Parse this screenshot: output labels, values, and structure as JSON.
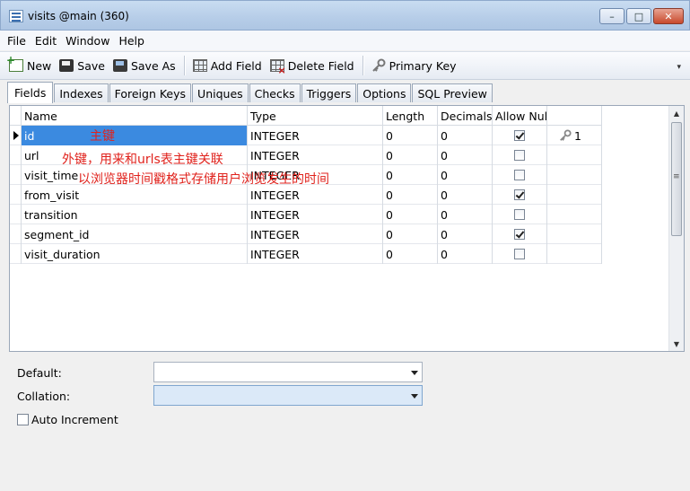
{
  "window": {
    "title": "visits @main (360)",
    "btn_min": "–",
    "btn_max": "□",
    "btn_close": "✕"
  },
  "menu": [
    "File",
    "Edit",
    "Window",
    "Help"
  ],
  "toolbar": {
    "new_label": "New",
    "save_label": "Save",
    "saveas_label": "Save As",
    "addfield_label": "Add Field",
    "deletefield_label": "Delete Field",
    "primarykey_label": "Primary Key",
    "overflow": "▾"
  },
  "tabs": [
    "Fields",
    "Indexes",
    "Foreign Keys",
    "Uniques",
    "Checks",
    "Triggers",
    "Options",
    "SQL Preview"
  ],
  "grid": {
    "headers": {
      "name": "Name",
      "type": "Type",
      "length": "Length",
      "decimals": "Decimals",
      "allow_null": "Allow Null"
    },
    "rows": [
      {
        "name": "id",
        "type": "INTEGER",
        "length": "0",
        "decimals": "0",
        "allow_null": true,
        "key": "1"
      },
      {
        "name": "url",
        "type": "INTEGER",
        "length": "0",
        "decimals": "0",
        "allow_null": false,
        "key": ""
      },
      {
        "name": "visit_time",
        "type": "INTEGER",
        "length": "0",
        "decimals": "0",
        "allow_null": false,
        "key": ""
      },
      {
        "name": "from_visit",
        "type": "INTEGER",
        "length": "0",
        "decimals": "0",
        "allow_null": true,
        "key": ""
      },
      {
        "name": "transition",
        "type": "INTEGER",
        "length": "0",
        "decimals": "0",
        "allow_null": false,
        "key": ""
      },
      {
        "name": "segment_id",
        "type": "INTEGER",
        "length": "0",
        "decimals": "0",
        "allow_null": true,
        "key": ""
      },
      {
        "name": "visit_duration",
        "type": "INTEGER",
        "length": "0",
        "decimals": "0",
        "allow_null": false,
        "key": ""
      }
    ]
  },
  "annotations": {
    "id_note": "主键",
    "url_note": "外键，用来和urls表主键关联",
    "visit_time_note": "以浏览器时间戳格式存储用户浏览发生的时间"
  },
  "props": {
    "default_label": "Default:",
    "default_value": "",
    "collation_label": "Collation:",
    "collation_value": "",
    "auto_increment_label": "Auto Increment"
  },
  "colors": {
    "selection": "#3b8ae0",
    "annotation": "#e0221c"
  }
}
